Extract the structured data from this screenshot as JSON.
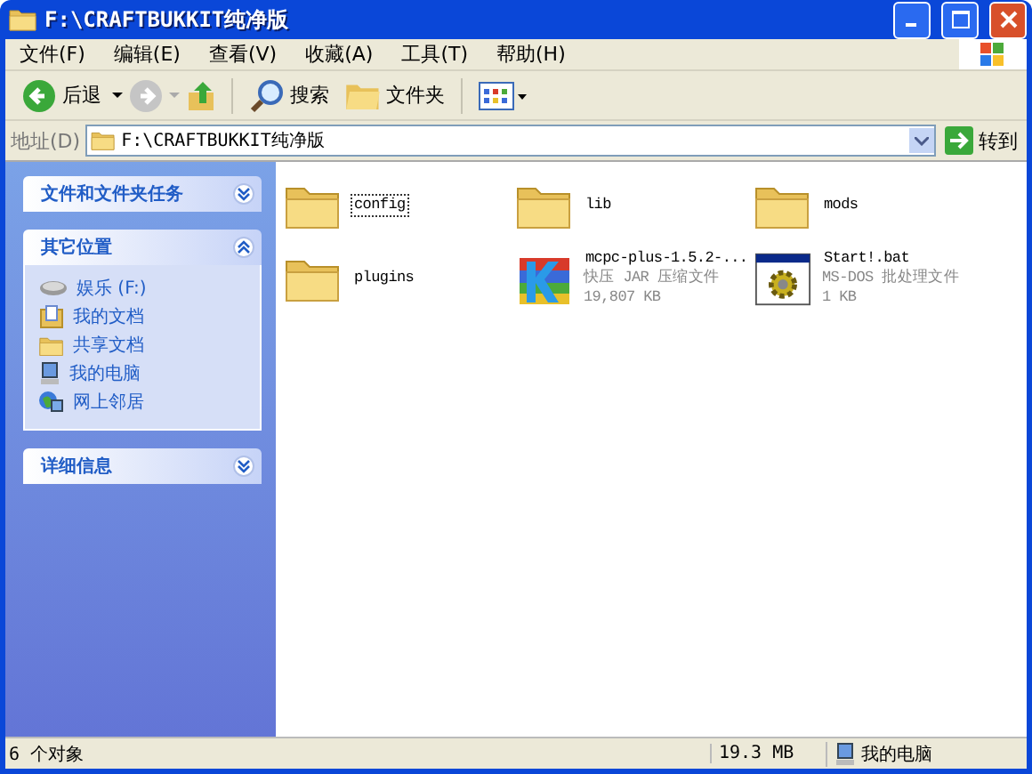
{
  "window": {
    "title": "F:\\CRAFTBUKKIT纯净版"
  },
  "menu": [
    "文件(F)",
    "编辑(E)",
    "查看(V)",
    "收藏(A)",
    "工具(T)",
    "帮助(H)"
  ],
  "toolbar": {
    "back": "后退",
    "search": "搜索",
    "folders": "文件夹"
  },
  "address": {
    "label": "地址(D)",
    "value": "F:\\CRAFTBUKKIT纯净版",
    "go": "转到"
  },
  "sidebar": [
    {
      "title": "文件和文件夹任务",
      "expanded": false
    },
    {
      "title": "其它位置",
      "expanded": true,
      "items": [
        {
          "kind": "drive",
          "label": "娱乐 (F:)"
        },
        {
          "kind": "docs",
          "label": "我的文档"
        },
        {
          "kind": "folder",
          "label": "共享文档"
        },
        {
          "kind": "computer",
          "label": "我的电脑"
        },
        {
          "kind": "network",
          "label": "网上邻居"
        }
      ]
    },
    {
      "title": "详细信息",
      "expanded": false
    }
  ],
  "files": [
    {
      "kind": "folder",
      "name": "config",
      "selected": true
    },
    {
      "kind": "folder",
      "name": "lib",
      "selected": false
    },
    {
      "kind": "folder",
      "name": "mods",
      "selected": false
    },
    {
      "kind": "folder",
      "name": "plugins",
      "selected": false
    },
    {
      "kind": "archive",
      "name": "mcpc-plus-1.5.2-...",
      "type": "快压 JAR 压缩文件",
      "size": "19,807 KB",
      "selected": false
    },
    {
      "kind": "batch",
      "name": "Start!.bat",
      "type": "MS-DOS 批处理文件",
      "size": "1 KB",
      "selected": false
    }
  ],
  "status_bar": {
    "objects": "6 个对象",
    "size": "19.3 MB",
    "location": "我的电脑"
  }
}
